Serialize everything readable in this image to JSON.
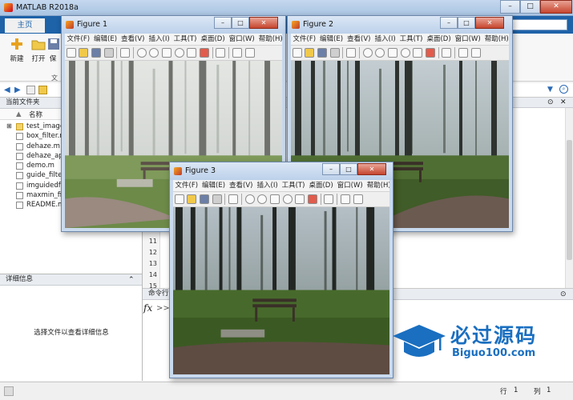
{
  "app": {
    "title": "MATLAB R2018a",
    "tabs": [
      "主页",
      "",
      "",
      ""
    ],
    "ribbon_buttons": [
      "新建",
      "打开",
      "保"
    ],
    "section_label": "文"
  },
  "current_folder": {
    "title": "当前文件夹",
    "column_header": "名称",
    "files": [
      {
        "name": "test_image",
        "type": "folder"
      },
      {
        "name": "box_filter.m",
        "type": "m-file"
      },
      {
        "name": "dehaze.m",
        "type": "m-file"
      },
      {
        "name": "dehaze_ap",
        "type": "m-file"
      },
      {
        "name": "demo.m",
        "type": "m-file"
      },
      {
        "name": "guide_filter",
        "type": "m-file"
      },
      {
        "name": "imguidedfi",
        "type": "m-file"
      },
      {
        "name": "maxmin_fil",
        "type": "m-file"
      },
      {
        "name": "README.m",
        "type": "m-file"
      }
    ]
  },
  "details": {
    "title": "详细信息",
    "message": "选择文件以查看详细信息"
  },
  "editor": {
    "line_numbers": [
      "11",
      "12",
      "13",
      "14",
      "15"
    ]
  },
  "command_window": {
    "title": "命令行窗",
    "fx_label": "fx",
    "prompt": ">>"
  },
  "status_bar": {
    "row_label": "行",
    "row_value": "1",
    "col_label": "列",
    "col_value": "1"
  },
  "figure_menu": [
    "文件(F)",
    "编辑(E)",
    "查看(V)",
    "插入(I)",
    "工具(T)",
    "桌面(D)",
    "窗口(W)",
    "帮助(H)"
  ],
  "figure_menu_overflow": "»",
  "window_buttons": {
    "minimize": "–",
    "maximize": "□",
    "close": "✕"
  },
  "figures": [
    {
      "title": "Figure 1",
      "image": "hazy-park-original"
    },
    {
      "title": "Figure 2",
      "image": "dehazed-park"
    },
    {
      "title": "Figure 3",
      "image": "dehazed-park-guided"
    }
  ],
  "watermark": {
    "title": "必过源码",
    "subtitle": "Biguo100.com"
  },
  "colors": {
    "ribbon_blue": "#1e62a8",
    "watermark_blue": "#1a6fc0"
  }
}
